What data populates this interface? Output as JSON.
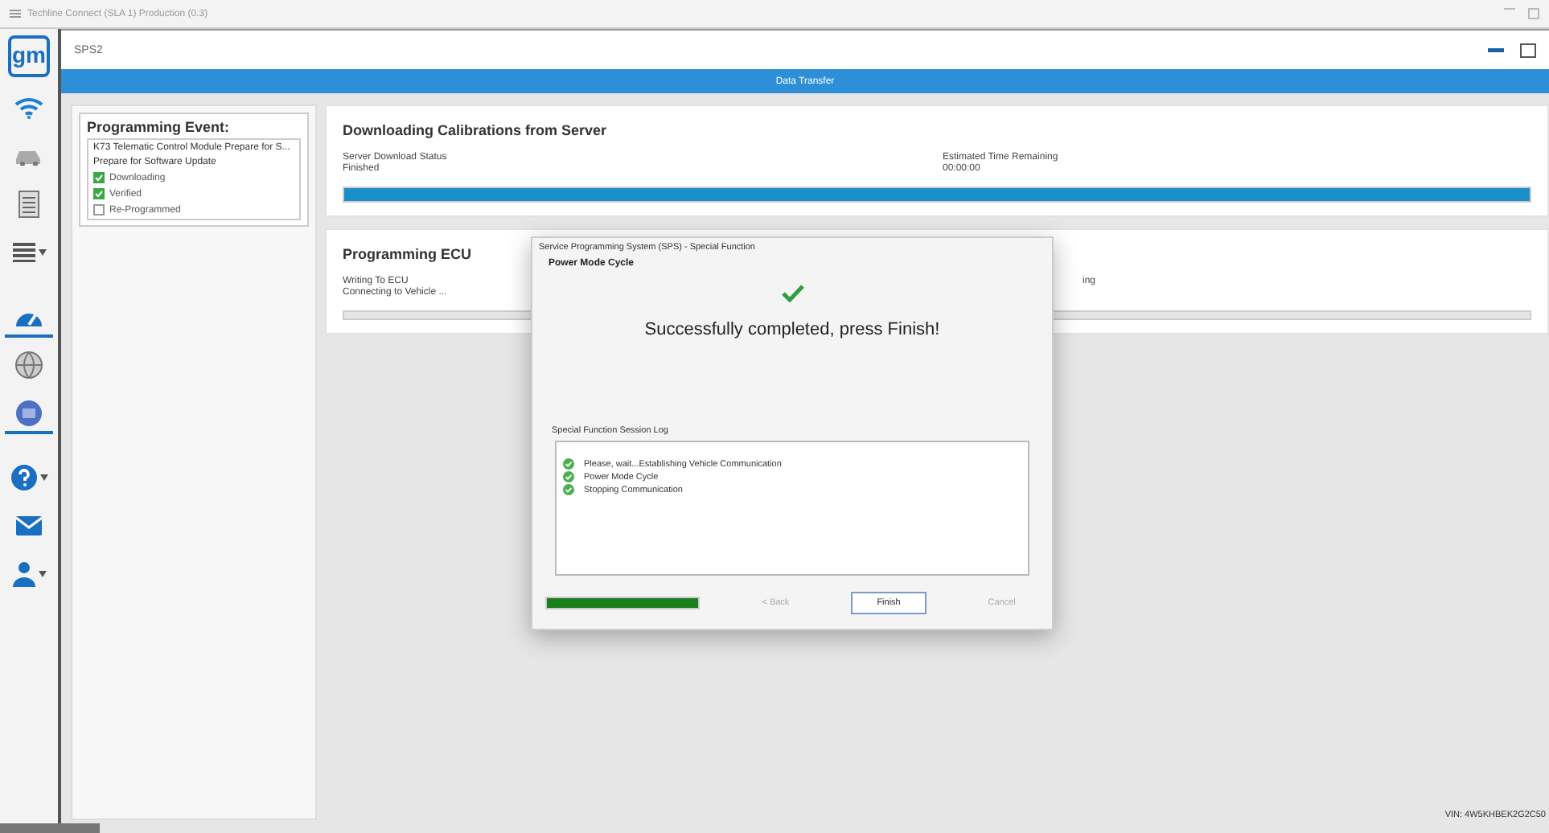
{
  "window": {
    "title": "Techline Connect (SLA 1) Production (0.3)"
  },
  "sidebar": {
    "logo": "gm",
    "items": [
      {
        "kind": "wifi"
      },
      {
        "kind": "car"
      },
      {
        "kind": "document"
      },
      {
        "kind": "list",
        "caret": true
      },
      {
        "kind": "gauge",
        "selected": true
      },
      {
        "kind": "globe",
        "selected": false
      },
      {
        "kind": "disc",
        "selected": true
      },
      {
        "kind": "help",
        "caret": true
      },
      {
        "kind": "mail"
      },
      {
        "kind": "person",
        "caret": true
      }
    ]
  },
  "app": {
    "title": "SPS2",
    "step_bar": "Data Transfer"
  },
  "programming_event": {
    "title": "Programming Event:",
    "module": "K73 Telematic Control Module Prepare for S...",
    "procedure": "Prepare for Software Update",
    "steps": [
      {
        "label": "Downloading",
        "checked": true
      },
      {
        "label": "Verified",
        "checked": true
      },
      {
        "label": "Re-Programmed",
        "checked": false
      }
    ]
  },
  "download_panel": {
    "title": "Downloading Calibrations from Server",
    "status_label": "Server Download Status",
    "status_value": "Finished",
    "time_label": "Estimated Time Remaining",
    "time_value": "00:00:00",
    "level": 1
  },
  "ecu_panel": {
    "title": "Programming ECU",
    "status_label": "Writing To ECU",
    "status_value": "Connecting to Vehicle ...",
    "right_fragment": "ing"
  },
  "dialog": {
    "title": "Service Programming System (SPS) - Special Function",
    "heading": "Power Mode Cycle",
    "message": "Successfully completed, press Finish!",
    "log_label": "Special Function Session Log",
    "log": [
      "Please, wait...Establishing Vehicle Communication",
      "Power Mode Cycle",
      "Stopping Communication"
    ],
    "level": 1,
    "buttons": [
      {
        "label": "< Back",
        "disabled": true
      },
      {
        "label": "Finish",
        "disabled": false
      },
      {
        "label": "Cancel",
        "disabled": true
      }
    ]
  },
  "vin": "VIN: 4W5KHBEK2G2C50"
}
